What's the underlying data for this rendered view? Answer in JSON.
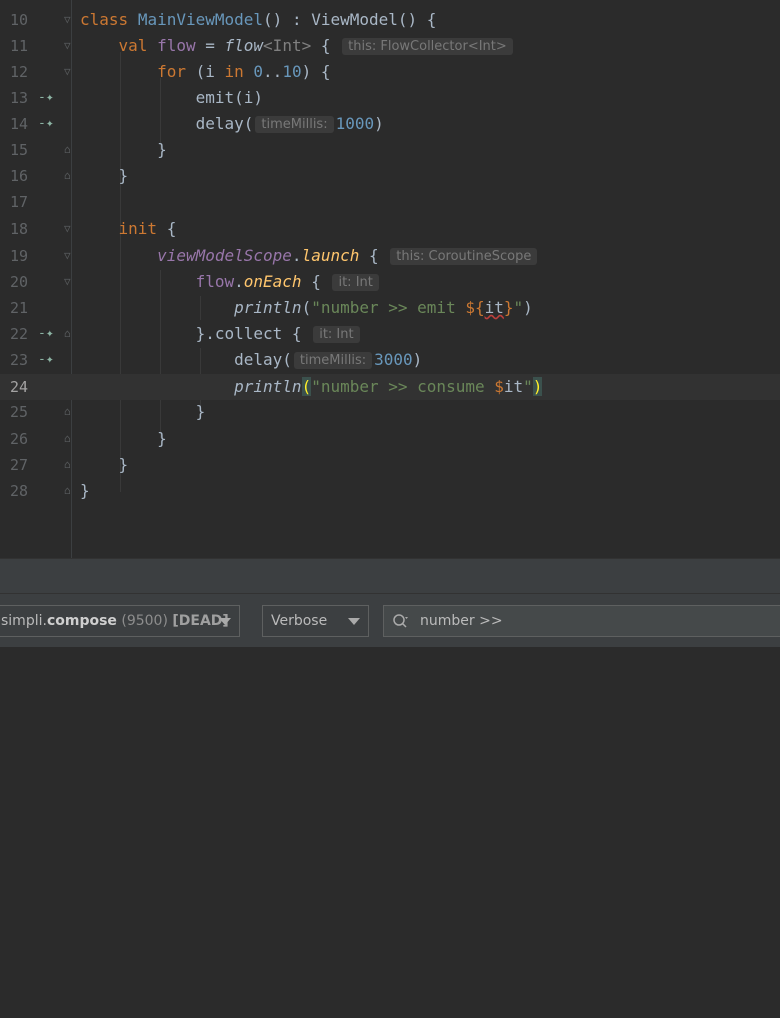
{
  "editor": {
    "lines": [
      {
        "n": "10"
      },
      {
        "n": "11"
      },
      {
        "n": "12"
      },
      {
        "n": "13"
      },
      {
        "n": "14"
      },
      {
        "n": "15"
      },
      {
        "n": "16"
      },
      {
        "n": "17"
      },
      {
        "n": "18"
      },
      {
        "n": "19"
      },
      {
        "n": "20"
      },
      {
        "n": "21"
      },
      {
        "n": "22"
      },
      {
        "n": "23"
      },
      {
        "n": "24"
      },
      {
        "n": "25"
      },
      {
        "n": "26"
      },
      {
        "n": "27"
      },
      {
        "n": "28"
      }
    ],
    "tokens": {
      "l10": {
        "kw": "class",
        "cls": "MainViewModel",
        "rest1": "() : ViewModel() {"
      },
      "l11": {
        "kw": "val",
        "prop": "flow",
        "eq": " = ",
        "fn": "flow",
        "type": "<Int>",
        "brace": " {",
        "hint": "this: FlowCollector<Int>"
      },
      "l12": {
        "kw": "for",
        "p1": " (i ",
        "kw2": "in",
        "sp": " ",
        "num1": "0",
        "dots": "..",
        "num2": "10",
        "p2": ") {"
      },
      "l13": {
        "code": "emit(i)"
      },
      "l14": {
        "fn": "delay(",
        "hint": "timeMillis:",
        "num": "1000",
        "close": ")"
      },
      "l15": {
        "code": "}"
      },
      "l16": {
        "code": "}"
      },
      "l17": {
        "code": ""
      },
      "l18": {
        "kw": "init",
        "rest": " {"
      },
      "l19": {
        "prop": "viewModelScope",
        "dot": ".",
        "ext": "launch",
        "brace": " {",
        "hint": "this: CoroutineScope"
      },
      "l20": {
        "prop": "flow",
        "dot": ".",
        "ext": "onEach",
        "brace": " {",
        "hint": "it: Int"
      },
      "l21": {
        "fn": "println",
        "open": "(",
        "str1": "\"number >> emit ",
        "tmpl1": "${",
        "it": "it",
        "tmpl2": "}",
        "str2": "\"",
        "close": ")"
      },
      "l22": {
        "code": "}.collect {",
        "hint": "it: Int"
      },
      "l23": {
        "fn": "delay(",
        "hint": "timeMillis:",
        "num": "3000",
        "close": ")"
      },
      "l24": {
        "fn": "println",
        "open": "(",
        "str1": "\"number >> consume ",
        "tmpl": "$",
        "it": "it",
        "str2": "\"",
        "close": ")"
      },
      "l25": {
        "code": "}"
      },
      "l26": {
        "code": "}"
      },
      "l27": {
        "code": "}"
      },
      "l28": {
        "code": "}"
      }
    }
  },
  "logcat": {
    "device_prefix": "simpli.",
    "device_name": "compose",
    "device_pid": "(9500)",
    "device_state": "[DEAD]",
    "level": "Verbose",
    "search_value": "number >>"
  },
  "icons": {
    "suspend": "suspend-call-icon",
    "fold": "fold-marker-icon",
    "search": "search-icon",
    "dropdown": "chevron-down-icon"
  }
}
